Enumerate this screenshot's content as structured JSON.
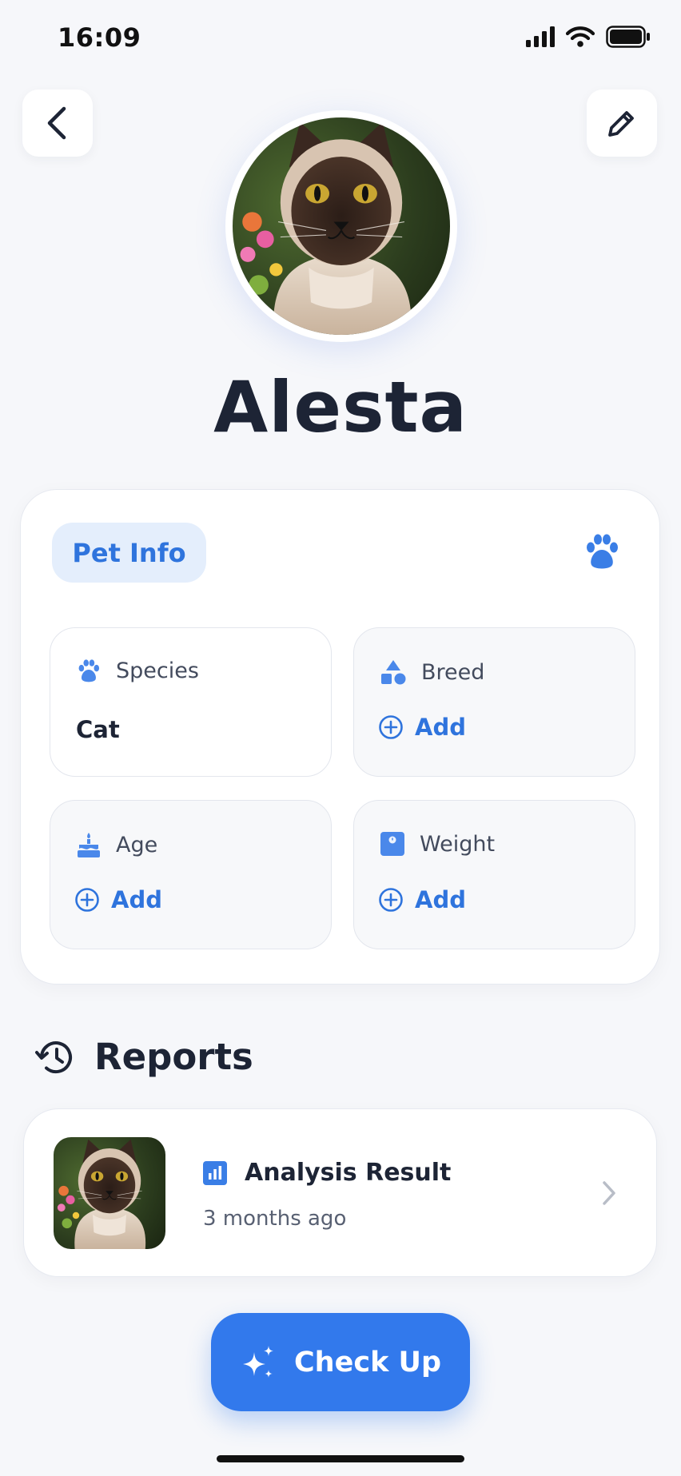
{
  "status_bar": {
    "time": "16:09"
  },
  "header": {
    "back_icon": "chevron-left-icon",
    "edit_icon": "pencil-icon"
  },
  "pet": {
    "name": "Alesta"
  },
  "pet_info": {
    "chip_label": "Pet Info",
    "tiles": [
      {
        "label": "Species",
        "value": "Cat",
        "icon": "paw-icon"
      },
      {
        "label": "Breed",
        "action": "Add",
        "icon": "shapes-icon"
      },
      {
        "label": "Age",
        "action": "Add",
        "icon": "cake-icon"
      },
      {
        "label": "Weight",
        "action": "Add",
        "icon": "scale-icon"
      }
    ]
  },
  "reports": {
    "title": "Reports",
    "items": [
      {
        "title": "Analysis Result",
        "time": "3 months ago",
        "icon": "bar-chart-icon"
      }
    ]
  },
  "cta": {
    "label": "Check Up",
    "icon": "sparkle-icon"
  },
  "colors": {
    "accent": "#3279ec",
    "text": "#1d2435",
    "chip_bg": "#e4eefc",
    "background": "#f6f7fa"
  }
}
